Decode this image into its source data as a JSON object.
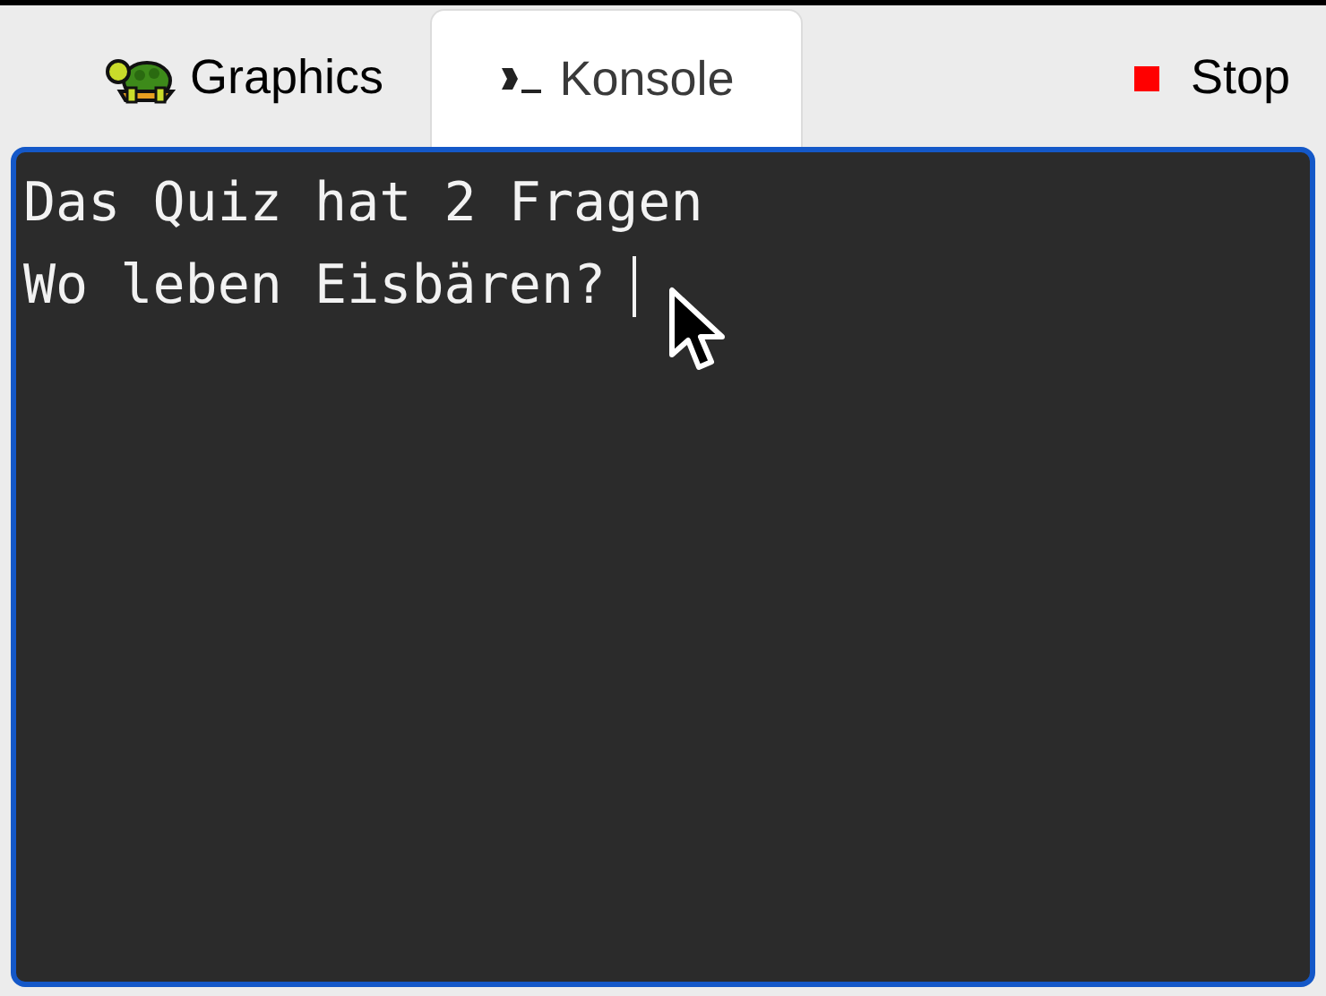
{
  "tabs": [
    {
      "label": "Graphics",
      "kind": "graphics",
      "selected": false
    },
    {
      "label": "Konsole",
      "kind": "console",
      "selected": true
    }
  ],
  "stop_button": {
    "label": "Stop"
  },
  "console": {
    "lines": [
      "Das Quiz hat 2 Fragen",
      "Wo leben Eisbären?"
    ],
    "focused": true
  }
}
